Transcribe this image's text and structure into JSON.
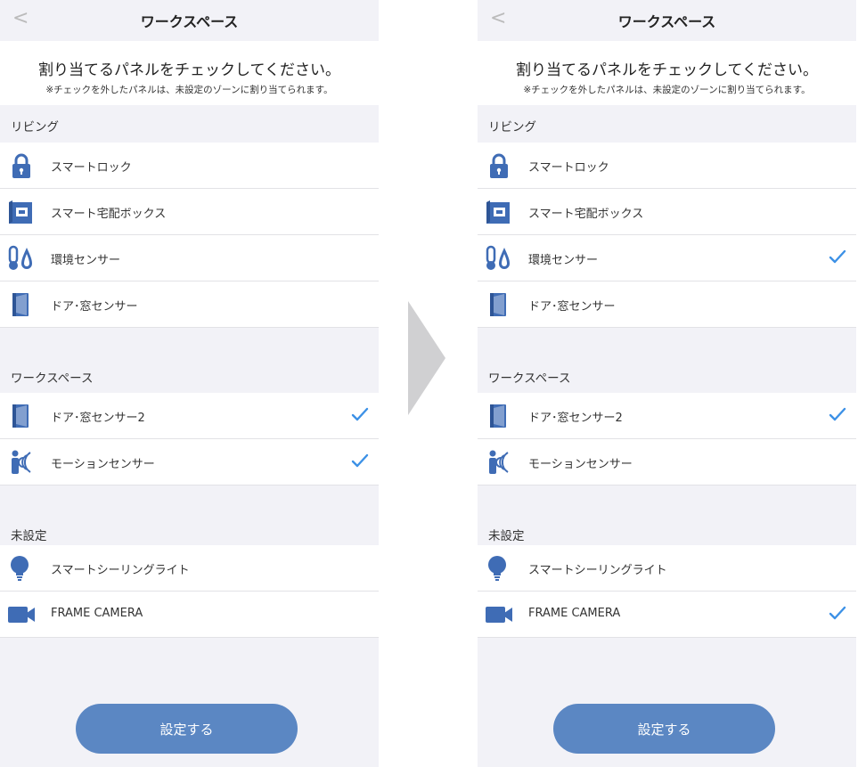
{
  "colors": {
    "icon": "#3f6cb5",
    "check": "#3c91e6",
    "button": "#5b87c3",
    "background": "#f2f2f7"
  },
  "screens": [
    {
      "id": "before",
      "nav": {
        "back_icon": "chevron-left-icon",
        "title": "ワークスペース"
      },
      "instructions": {
        "main": "割り当てるパネルをチェックしてください。",
        "note": "※チェックを外したパネルは、未設定のゾーンに割り当てられます。"
      },
      "sections": [
        {
          "label": "リビング",
          "items": [
            {
              "label": "スマートロック",
              "icon": "lock-icon",
              "checked": false
            },
            {
              "label": "スマート宅配ボックス",
              "icon": "delivery-box-icon",
              "checked": false
            },
            {
              "label": "環境センサー",
              "icon": "environment-sensor-icon",
              "checked": false
            },
            {
              "label": "ドア･窓センサー",
              "icon": "door-sensor-icon",
              "checked": false
            }
          ]
        },
        {
          "label": "ワークスペース",
          "items": [
            {
              "label": "ドア･窓センサー2",
              "icon": "door-sensor-icon",
              "checked": true
            },
            {
              "label": "モーションセンサー",
              "icon": "motion-sensor-icon",
              "checked": true
            }
          ]
        },
        {
          "label": "未設定",
          "items": [
            {
              "label": "スマートシーリングライト",
              "icon": "light-bulb-icon",
              "checked": false
            },
            {
              "label": "FRAME CAMERA",
              "icon": "camera-icon",
              "checked": false
            }
          ]
        }
      ],
      "submit_label": "設定する"
    },
    {
      "id": "after",
      "nav": {
        "back_icon": "chevron-left-icon",
        "title": "ワークスペース"
      },
      "instructions": {
        "main": "割り当てるパネルをチェックしてください。",
        "note": "※チェックを外したパネルは、未設定のゾーンに割り当てられます。"
      },
      "sections": [
        {
          "label": "リビング",
          "items": [
            {
              "label": "スマートロック",
              "icon": "lock-icon",
              "checked": false
            },
            {
              "label": "スマート宅配ボックス",
              "icon": "delivery-box-icon",
              "checked": false
            },
            {
              "label": "環境センサー",
              "icon": "environment-sensor-icon",
              "checked": true
            },
            {
              "label": "ドア･窓センサー",
              "icon": "door-sensor-icon",
              "checked": false
            }
          ]
        },
        {
          "label": "ワークスペース",
          "items": [
            {
              "label": "ドア･窓センサー2",
              "icon": "door-sensor-icon",
              "checked": true
            },
            {
              "label": "モーションセンサー",
              "icon": "motion-sensor-icon",
              "checked": false
            }
          ]
        },
        {
          "label": "未設定",
          "items": [
            {
              "label": "スマートシーリングライト",
              "icon": "light-bulb-icon",
              "checked": false
            },
            {
              "label": "FRAME CAMERA",
              "icon": "camera-icon",
              "checked": true
            }
          ]
        }
      ],
      "submit_label": "設定する"
    }
  ],
  "transition_icon": "arrow-right-icon"
}
